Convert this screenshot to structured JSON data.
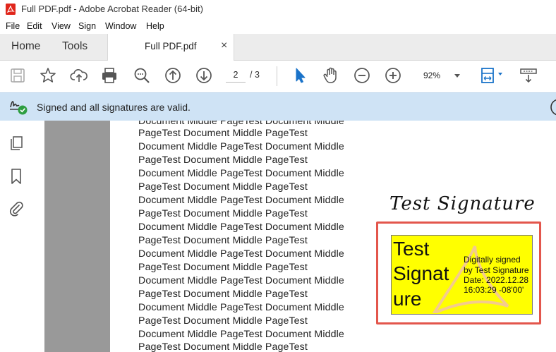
{
  "window": {
    "title": "Full PDF.pdf - Adobe Acrobat Reader (64-bit)"
  },
  "menu": {
    "items": [
      "File",
      "Edit",
      "View",
      "Sign",
      "Window",
      "Help"
    ]
  },
  "tabs": {
    "home": "Home",
    "tools": "Tools",
    "document": "Full PDF.pdf",
    "close_symbol": "×"
  },
  "toolbar": {
    "current_page": "2",
    "page_total": "/ 3",
    "zoom": "92%",
    "icons": [
      "save-icon",
      "bookmark-star-icon",
      "upload-icon",
      "print-icon",
      "find-icon",
      "page-up-icon",
      "page-down-icon",
      "select-cursor-icon",
      "hand-icon",
      "zoom-out-icon",
      "zoom-in-icon",
      "page-fit-icon",
      "scroll-mode-icon"
    ]
  },
  "signature_bar": {
    "message": "Signed and all signatures are valid."
  },
  "document": {
    "lines": [
      "Document Middle PageTest Document Middle",
      "PageTest Document Middle PageTest",
      "Document Middle PageTest Document Middle",
      "PageTest Document Middle PageTest",
      "Document Middle PageTest Document Middle",
      "PageTest Document Middle PageTest",
      "Document Middle PageTest Document Middle",
      "PageTest Document Middle PageTest",
      "Document Middle PageTest Document Middle",
      "PageTest Document Middle PageTest",
      "Document Middle PageTest Document Middle",
      "PageTest Document Middle PageTest",
      "Document Middle PageTest Document Middle",
      "PageTest Document Middle PageTest",
      "Document Middle PageTest Document Middle",
      "PageTest Document Middle PageTest",
      "Document Middle PageTest Document Middle",
      "PageTest Document Middle PageTest"
    ],
    "handwritten_signature": "Test Signature",
    "signature_field": {
      "name_lines": [
        "Test",
        "Signat",
        "ure"
      ],
      "details": [
        "Digitally signed",
        "by Test Signature",
        "Date: 2022.12.28",
        "16:03:29 -08'00'"
      ]
    }
  }
}
